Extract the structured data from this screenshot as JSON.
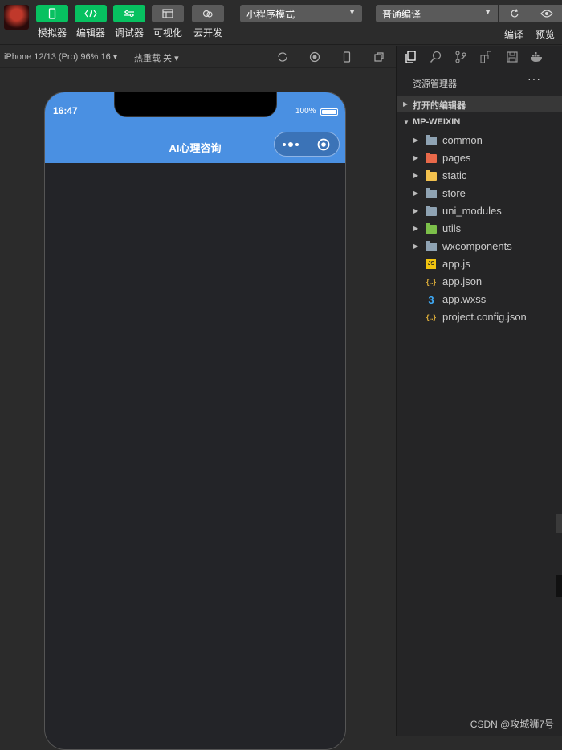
{
  "toolbar": {
    "tools": [
      {
        "label": "模拟器",
        "icon": "phone-icon"
      },
      {
        "label": "编辑器",
        "icon": "code-icon"
      },
      {
        "label": "调试器",
        "icon": "debug-icon"
      },
      {
        "label": "可视化",
        "icon": "layout-icon"
      },
      {
        "label": "云开发",
        "icon": "cloud-icon"
      }
    ],
    "mode_select": "小程序模式",
    "compile_select": "普通编译",
    "compile_label": "编译",
    "preview_label": "预览"
  },
  "subbar": {
    "device": "iPhone 12/13 (Pro) 96% 16 ▾",
    "hot_reload": "热重载 关 ▾"
  },
  "phone": {
    "time": "16:47",
    "battery": "100%",
    "nav_title": "AI心理咨询"
  },
  "explorer": {
    "title": "资源管理器",
    "more": "···",
    "open_editors": "打开的编辑器",
    "project": "MP-WEIXIN",
    "items": [
      {
        "name": "common",
        "type": "folder",
        "color": "#8fa3b3"
      },
      {
        "name": "pages",
        "type": "folder",
        "color": "#e8694a"
      },
      {
        "name": "static",
        "type": "folder",
        "color": "#f2c14e"
      },
      {
        "name": "store",
        "type": "folder",
        "color": "#8fa3b3"
      },
      {
        "name": "uni_modules",
        "type": "folder",
        "color": "#8fa3b3"
      },
      {
        "name": "utils",
        "type": "folder",
        "color": "#7cbf4a"
      },
      {
        "name": "wxcomponents",
        "type": "folder",
        "color": "#8fa3b3"
      },
      {
        "name": "app.js",
        "type": "js"
      },
      {
        "name": "app.json",
        "type": "json"
      },
      {
        "name": "app.wxss",
        "type": "css"
      },
      {
        "name": "project.config.json",
        "type": "json"
      }
    ]
  },
  "watermark": "CSDN @攻城狮7号",
  "colors": {
    "accent_green": "#07c160",
    "nav_blue": "#4a90e2"
  }
}
